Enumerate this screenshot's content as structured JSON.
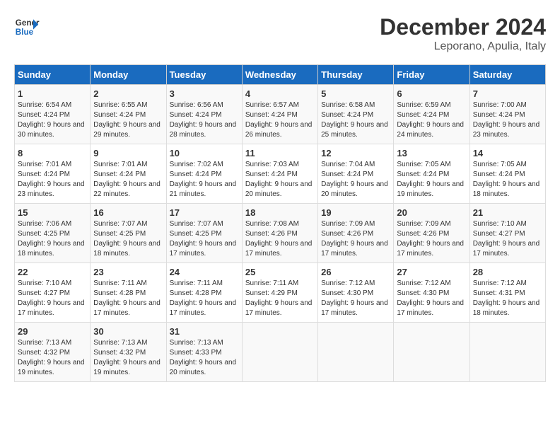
{
  "logo": {
    "text_general": "General",
    "text_blue": "Blue"
  },
  "title": "December 2024",
  "subtitle": "Leporano, Apulia, Italy",
  "weekdays": [
    "Sunday",
    "Monday",
    "Tuesday",
    "Wednesday",
    "Thursday",
    "Friday",
    "Saturday"
  ],
  "weeks": [
    [
      {
        "day": "1",
        "sunrise": "6:54 AM",
        "sunset": "4:24 PM",
        "daylight": "9 hours and 30 minutes."
      },
      {
        "day": "2",
        "sunrise": "6:55 AM",
        "sunset": "4:24 PM",
        "daylight": "9 hours and 29 minutes."
      },
      {
        "day": "3",
        "sunrise": "6:56 AM",
        "sunset": "4:24 PM",
        "daylight": "9 hours and 28 minutes."
      },
      {
        "day": "4",
        "sunrise": "6:57 AM",
        "sunset": "4:24 PM",
        "daylight": "9 hours and 26 minutes."
      },
      {
        "day": "5",
        "sunrise": "6:58 AM",
        "sunset": "4:24 PM",
        "daylight": "9 hours and 25 minutes."
      },
      {
        "day": "6",
        "sunrise": "6:59 AM",
        "sunset": "4:24 PM",
        "daylight": "9 hours and 24 minutes."
      },
      {
        "day": "7",
        "sunrise": "7:00 AM",
        "sunset": "4:24 PM",
        "daylight": "9 hours and 23 minutes."
      }
    ],
    [
      {
        "day": "8",
        "sunrise": "7:01 AM",
        "sunset": "4:24 PM",
        "daylight": "9 hours and 23 minutes."
      },
      {
        "day": "9",
        "sunrise": "7:01 AM",
        "sunset": "4:24 PM",
        "daylight": "9 hours and 22 minutes."
      },
      {
        "day": "10",
        "sunrise": "7:02 AM",
        "sunset": "4:24 PM",
        "daylight": "9 hours and 21 minutes."
      },
      {
        "day": "11",
        "sunrise": "7:03 AM",
        "sunset": "4:24 PM",
        "daylight": "9 hours and 20 minutes."
      },
      {
        "day": "12",
        "sunrise": "7:04 AM",
        "sunset": "4:24 PM",
        "daylight": "9 hours and 20 minutes."
      },
      {
        "day": "13",
        "sunrise": "7:05 AM",
        "sunset": "4:24 PM",
        "daylight": "9 hours and 19 minutes."
      },
      {
        "day": "14",
        "sunrise": "7:05 AM",
        "sunset": "4:24 PM",
        "daylight": "9 hours and 18 minutes."
      }
    ],
    [
      {
        "day": "15",
        "sunrise": "7:06 AM",
        "sunset": "4:25 PM",
        "daylight": "9 hours and 18 minutes."
      },
      {
        "day": "16",
        "sunrise": "7:07 AM",
        "sunset": "4:25 PM",
        "daylight": "9 hours and 18 minutes."
      },
      {
        "day": "17",
        "sunrise": "7:07 AM",
        "sunset": "4:25 PM",
        "daylight": "9 hours and 17 minutes."
      },
      {
        "day": "18",
        "sunrise": "7:08 AM",
        "sunset": "4:26 PM",
        "daylight": "9 hours and 17 minutes."
      },
      {
        "day": "19",
        "sunrise": "7:09 AM",
        "sunset": "4:26 PM",
        "daylight": "9 hours and 17 minutes."
      },
      {
        "day": "20",
        "sunrise": "7:09 AM",
        "sunset": "4:26 PM",
        "daylight": "9 hours and 17 minutes."
      },
      {
        "day": "21",
        "sunrise": "7:10 AM",
        "sunset": "4:27 PM",
        "daylight": "9 hours and 17 minutes."
      }
    ],
    [
      {
        "day": "22",
        "sunrise": "7:10 AM",
        "sunset": "4:27 PM",
        "daylight": "9 hours and 17 minutes."
      },
      {
        "day": "23",
        "sunrise": "7:11 AM",
        "sunset": "4:28 PM",
        "daylight": "9 hours and 17 minutes."
      },
      {
        "day": "24",
        "sunrise": "7:11 AM",
        "sunset": "4:28 PM",
        "daylight": "9 hours and 17 minutes."
      },
      {
        "day": "25",
        "sunrise": "7:11 AM",
        "sunset": "4:29 PM",
        "daylight": "9 hours and 17 minutes."
      },
      {
        "day": "26",
        "sunrise": "7:12 AM",
        "sunset": "4:30 PM",
        "daylight": "9 hours and 17 minutes."
      },
      {
        "day": "27",
        "sunrise": "7:12 AM",
        "sunset": "4:30 PM",
        "daylight": "9 hours and 17 minutes."
      },
      {
        "day": "28",
        "sunrise": "7:12 AM",
        "sunset": "4:31 PM",
        "daylight": "9 hours and 18 minutes."
      }
    ],
    [
      {
        "day": "29",
        "sunrise": "7:13 AM",
        "sunset": "4:32 PM",
        "daylight": "9 hours and 19 minutes."
      },
      {
        "day": "30",
        "sunrise": "7:13 AM",
        "sunset": "4:32 PM",
        "daylight": "9 hours and 19 minutes."
      },
      {
        "day": "31",
        "sunrise": "7:13 AM",
        "sunset": "4:33 PM",
        "daylight": "9 hours and 20 minutes."
      },
      {
        "day": "",
        "sunrise": "",
        "sunset": "",
        "daylight": ""
      },
      {
        "day": "",
        "sunrise": "",
        "sunset": "",
        "daylight": ""
      },
      {
        "day": "",
        "sunrise": "",
        "sunset": "",
        "daylight": ""
      },
      {
        "day": "",
        "sunrise": "",
        "sunset": "",
        "daylight": ""
      }
    ]
  ]
}
